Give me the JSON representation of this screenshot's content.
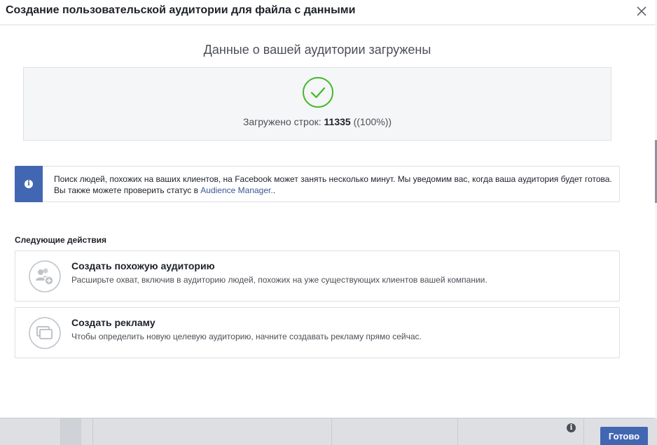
{
  "dialog": {
    "title": "Создание пользовательской аудитории для файла с данными",
    "close_icon": "close-icon"
  },
  "upload": {
    "subtitle": "Данные о вашей аудитории загружены",
    "status_icon": "check-circle-icon",
    "rows_label": "Загружено строк:",
    "rows_count": "11335",
    "rows_percent": "((100%))"
  },
  "notice": {
    "icon": "info-icon",
    "text": "Поиск людей, похожих на ваших клиентов, на Facebook может занять несколько минут. Мы уведомим вас, когда ваша аудитория будет готова. Вы также можете проверить статус в ",
    "link_text": "Audience Manager.",
    "suffix": "."
  },
  "next_steps": {
    "heading": "Следующие действия",
    "actions": [
      {
        "icon": "lookalike-audience-icon",
        "title": "Создать похожую аудиторию",
        "description": "Расширьте охват, включив в аудиторию людей, похожих на уже существующих клиентов вашей компании."
      },
      {
        "icon": "create-ad-icon",
        "title": "Создать рекламу",
        "description": "Чтобы определить новую целевую аудиторию, начните создавать рекламу прямо сейчас."
      }
    ]
  },
  "footer": {
    "done_label": "Готово"
  },
  "colors": {
    "accent": "#4267b2",
    "success": "#42b72a",
    "link": "#385898"
  }
}
